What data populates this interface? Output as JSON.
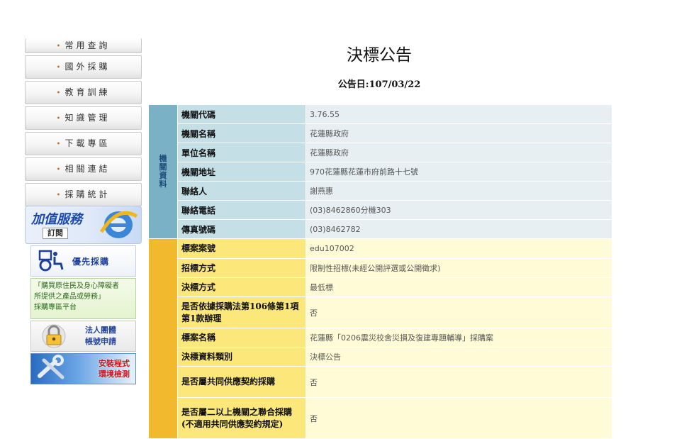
{
  "sidebar": {
    "items": [
      {
        "label": "常用查詢"
      },
      {
        "label": "國外採購"
      },
      {
        "label": "教育訓練"
      },
      {
        "label": "知識管理"
      },
      {
        "label": "下載專區"
      },
      {
        "label": "相關連結"
      },
      {
        "label": "採購統計"
      }
    ],
    "banners": {
      "value_added": {
        "title": "加值服務",
        "subtitle": "訂閱"
      },
      "priority": {
        "label": "優先採購"
      },
      "indigenous": {
        "lines": [
          "「購買原住民及身心障礙者",
          "所提供之產品或勞務」",
          "採購專區平台"
        ]
      },
      "corporate": {
        "line1": "法人團體",
        "line2": "帳號申請"
      },
      "install": {
        "line1": "安裝程式",
        "line2": "環境檢測"
      }
    }
  },
  "main": {
    "title": "決標公告",
    "announce_date": "公告日:107/03/22",
    "agency_group_label": "機關資料",
    "agency_rows": [
      {
        "label": "機關代碼",
        "value": "3.76.55"
      },
      {
        "label": "機關名稱",
        "value": "花蓮縣政府"
      },
      {
        "label": "單位名稱",
        "value": "花蓮縣政府"
      },
      {
        "label": "機關地址",
        "value": "970花蓮縣花蓮市府前路十七號"
      },
      {
        "label": "聯絡人",
        "value": "謝燕惠"
      },
      {
        "label": "聯絡電話",
        "value": "(03)8462860分機303"
      },
      {
        "label": "傳真號碼",
        "value": "(03)8462782"
      }
    ],
    "tender_rows": [
      {
        "label": "標案案號",
        "value": "edu107002"
      },
      {
        "label": "招標方式",
        "value": "限制性招標(未經公開評選或公開徵求)"
      },
      {
        "label": "決標方式",
        "value": "最低標"
      },
      {
        "label": "是否依據採購法第106條第1項第1款辦理",
        "value": "否"
      },
      {
        "label": "標案名稱",
        "value": "花蓮縣「0206震災校舍災損及復建專題輔導」採購案"
      },
      {
        "label": "決標資料類別",
        "value": "決標公告"
      },
      {
        "label": "是否屬共同供應契約採購",
        "value": "否"
      },
      {
        "label": "是否屬二以上機關之聯合採購(不適用共同供應契約規定)",
        "value": "否"
      }
    ]
  },
  "colors": {
    "agency_group": "#7ab1c5",
    "agency_label": "#c5dfe7",
    "agency_value": "#e7eff2",
    "tender_group": "#f0b92e",
    "tender_label": "#fbe77a",
    "tender_value": "#fffbd6"
  }
}
